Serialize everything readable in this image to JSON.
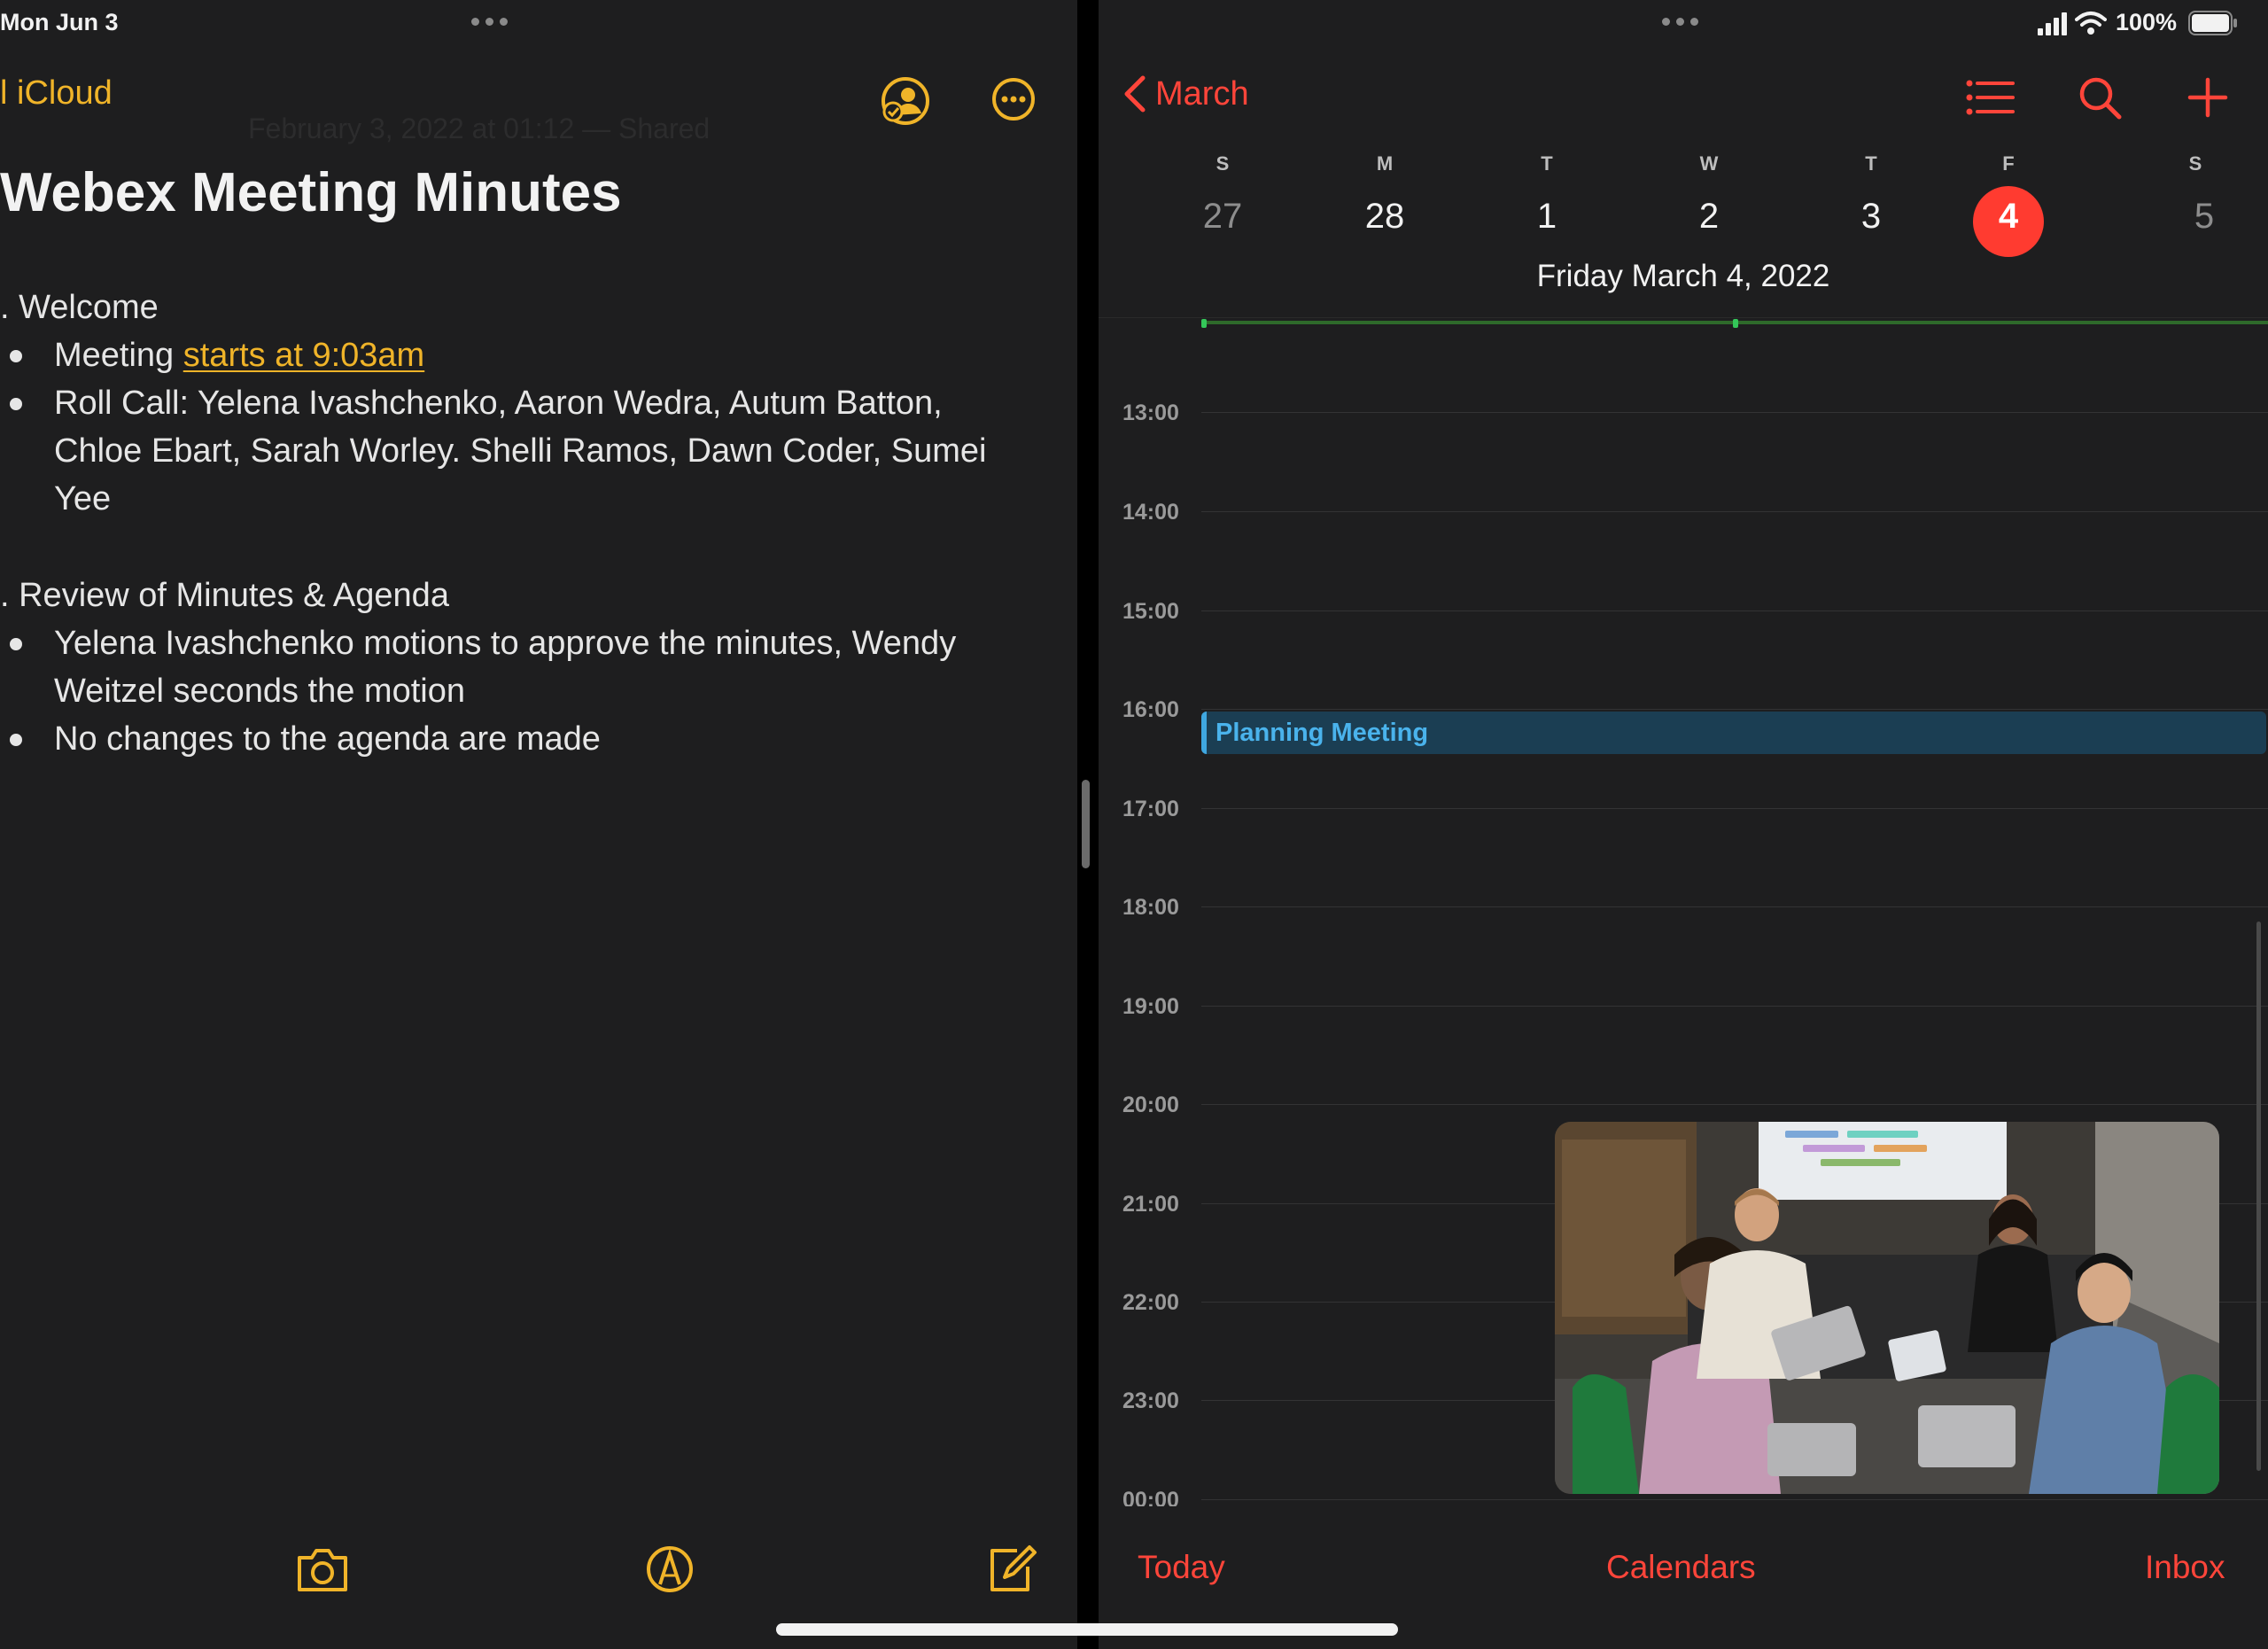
{
  "notes": {
    "status_time": "Mon Jun 3",
    "back_label": "l iCloud",
    "faint_subtitle": "February 3, 2022 at 01:12 — Shared",
    "title": "Webex Meeting Minutes",
    "sections": [
      {
        "heading": ". Welcome",
        "bullets": [
          {
            "lines": [
              "Meeting "
            ],
            "link": "starts at 9:03am"
          },
          {
            "lines": [
              "Roll Call: Yelena Ivashchenko, Aaron Wedra, Autum Batton,",
              "Chloe Ebart, Sarah Worley. Shelli Ramos, Dawn Coder, Sumei",
              "Yee"
            ]
          }
        ]
      },
      {
        "heading": ". Review of Minutes & Agenda",
        "bullets": [
          {
            "lines": [
              "Yelena Ivashchenko motions to approve the minutes, Wendy",
              "Weitzel seconds the motion"
            ]
          },
          {
            "lines": [
              "No changes to the agenda are made"
            ]
          }
        ]
      }
    ],
    "icons": {
      "collaborate": "person-checkmark-icon",
      "more": "ellipsis-circle-icon",
      "camera": "camera-icon",
      "markup": "pen-tip-icon",
      "compose": "compose-icon"
    },
    "accent": "#f0b429"
  },
  "calendar": {
    "status": {
      "battery": "100%"
    },
    "back_label": "March",
    "icons": {
      "list": "list-icon",
      "search": "search-icon",
      "add": "plus-icon"
    },
    "week": [
      {
        "letter": "S",
        "num": "27",
        "muted": true
      },
      {
        "letter": "M",
        "num": "28"
      },
      {
        "letter": "T",
        "num": "1"
      },
      {
        "letter": "W",
        "num": "2"
      },
      {
        "letter": "T",
        "num": "3"
      },
      {
        "letter": "F",
        "num": "4",
        "selected": true
      },
      {
        "letter": "S",
        "num": "5",
        "muted": true
      }
    ],
    "selected_date": "Friday  March 4, 2022",
    "hours": [
      "13:00",
      "14:00",
      "15:00",
      "16:00",
      "17:00",
      "18:00",
      "19:00",
      "20:00",
      "21:00",
      "22:00",
      "23:00",
      "00:00"
    ],
    "event": {
      "title": "Planning Meeting",
      "color": "#3fa7e0"
    },
    "tabs": {
      "today": "Today",
      "calendars": "Calendars",
      "inbox": "Inbox"
    },
    "accent": "#ff453a"
  }
}
